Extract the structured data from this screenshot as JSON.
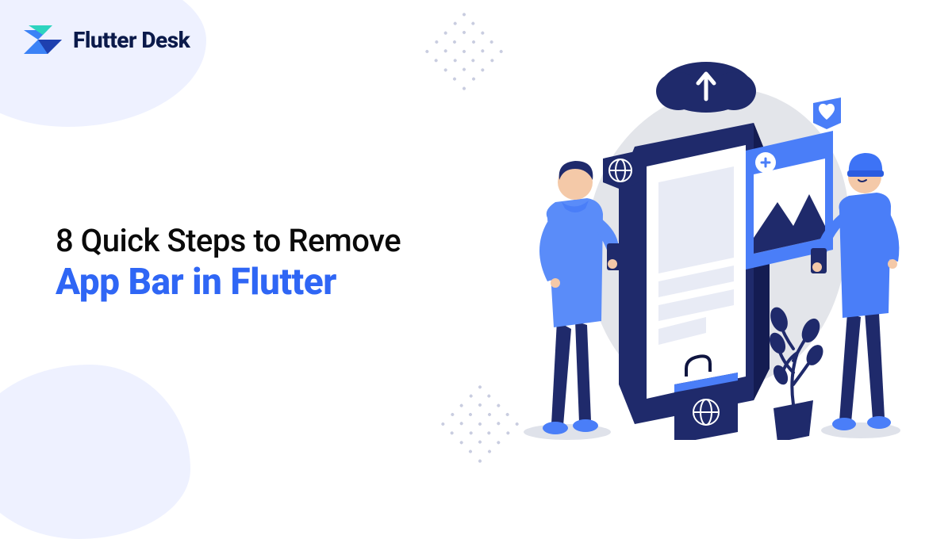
{
  "brand": {
    "name": "Flutter Desk"
  },
  "heading": {
    "line1": "8 Quick Steps to Remove",
    "line2": "App Bar in Flutter"
  },
  "colors": {
    "accent": "#2f66f5",
    "dark_navy": "#1f2a6b",
    "blob": "#eef1ff",
    "text_dark": "#0a0a0a"
  },
  "illustration": {
    "description": "two-people-phone-mockup"
  }
}
